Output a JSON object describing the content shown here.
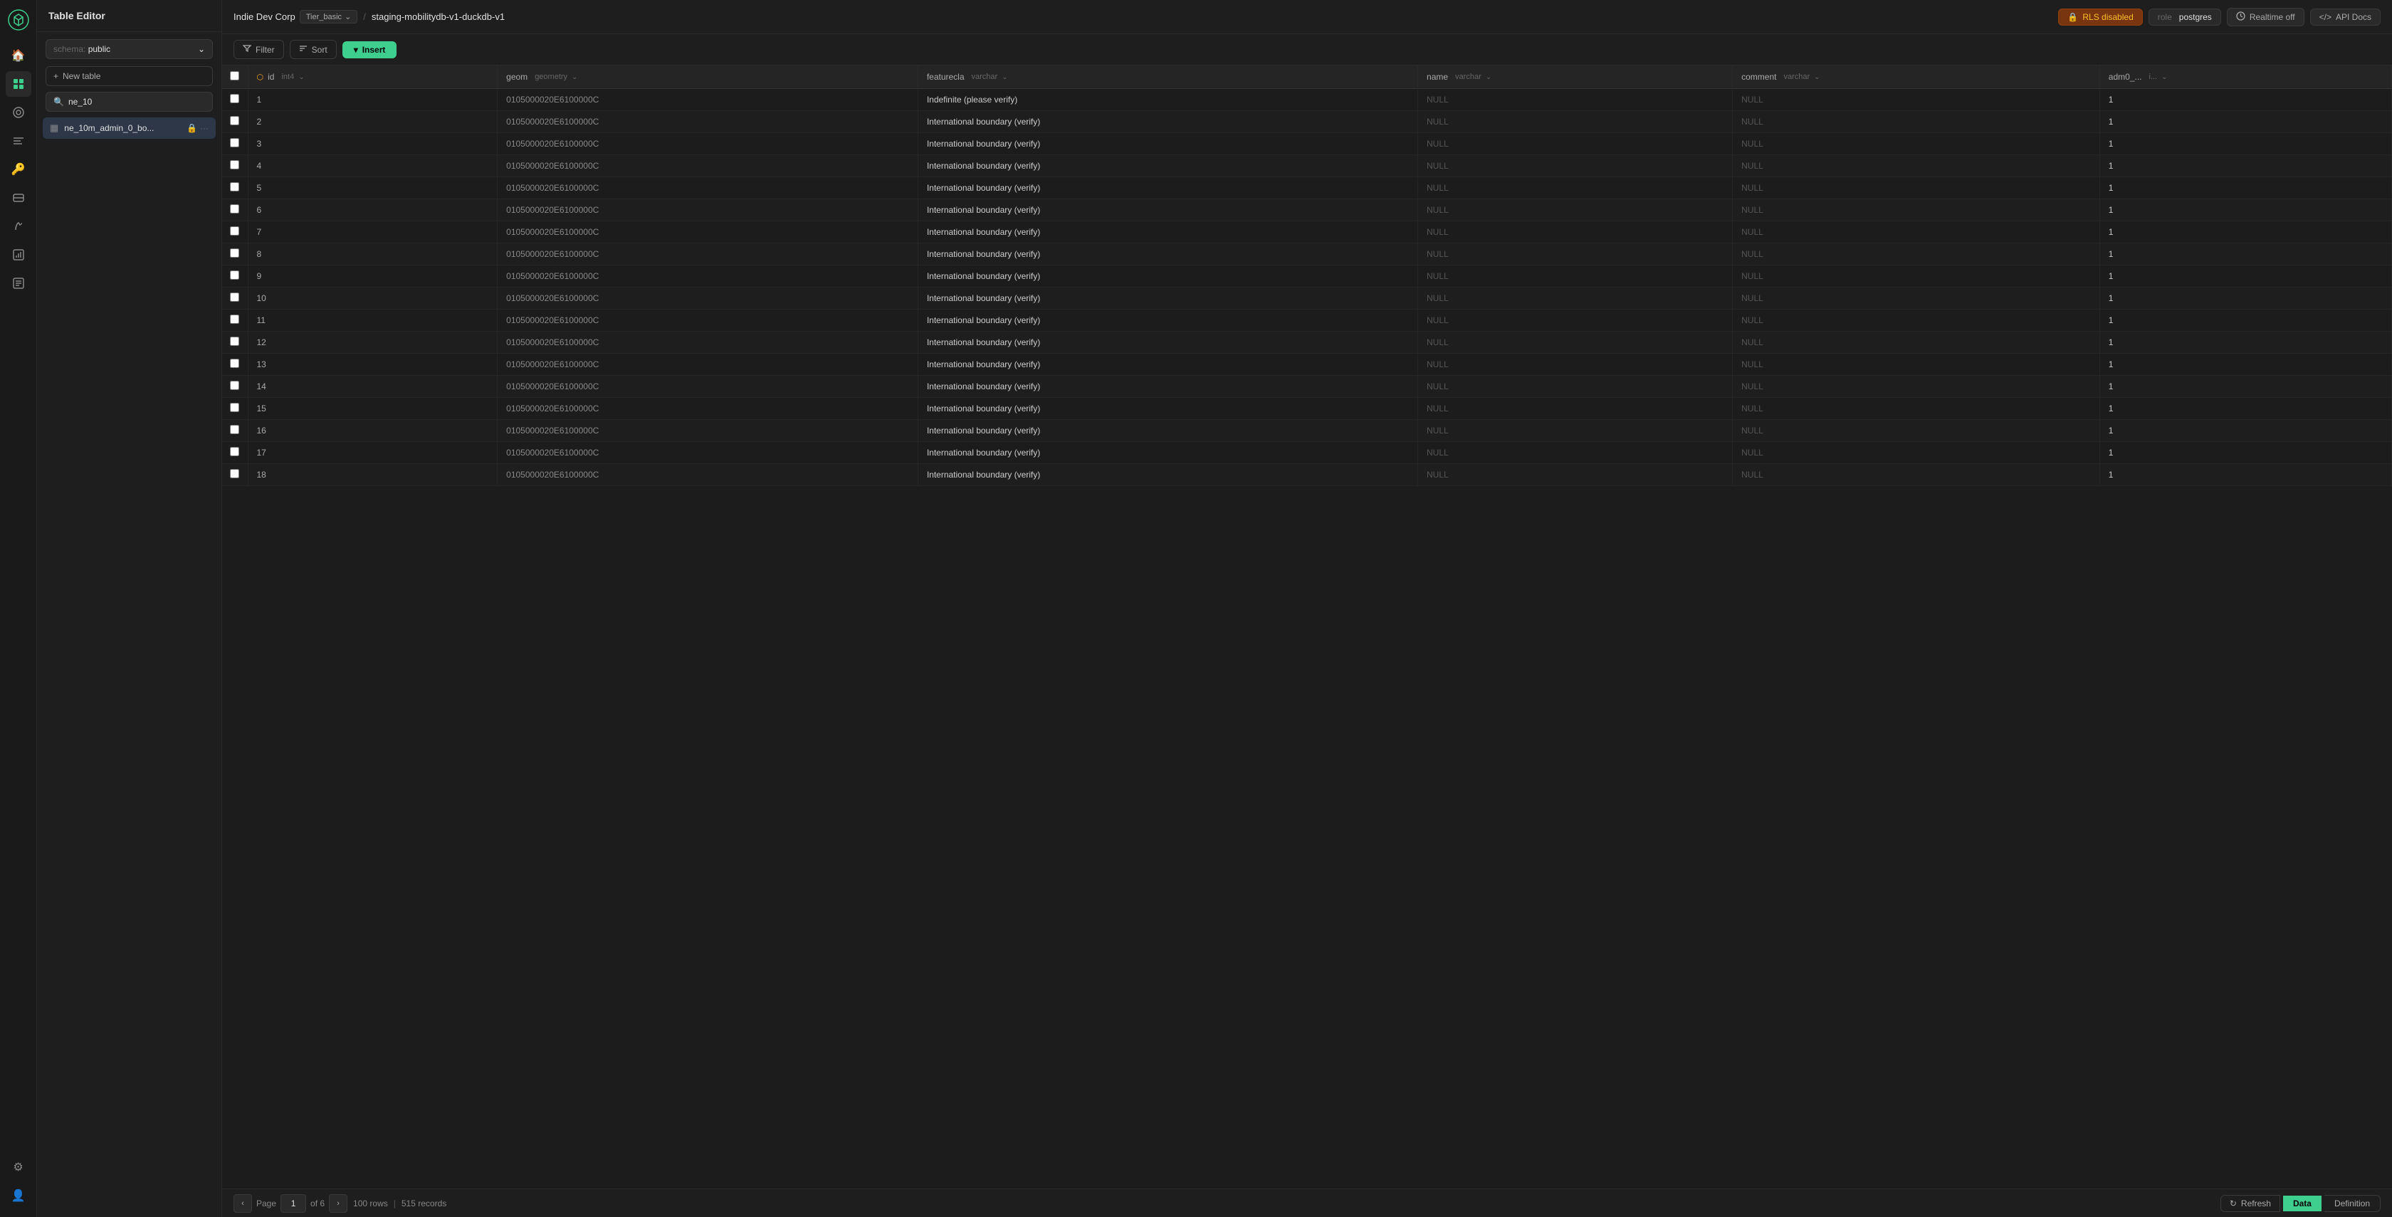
{
  "app": {
    "title": "Table Editor"
  },
  "sidebar": {
    "icons": [
      {
        "name": "home-icon",
        "glyph": "⌂",
        "active": false
      },
      {
        "name": "table-editor-icon",
        "glyph": "▦",
        "active": true
      },
      {
        "name": "schema-icon",
        "glyph": "◈",
        "active": false
      },
      {
        "name": "sql-editor-icon",
        "glyph": "≡",
        "active": false
      },
      {
        "name": "auth-icon",
        "glyph": "🔑",
        "active": false
      },
      {
        "name": "storage-icon",
        "glyph": "📁",
        "active": false
      },
      {
        "name": "functions-icon",
        "glyph": "ƒ",
        "active": false
      },
      {
        "name": "reports-icon",
        "glyph": "📊",
        "active": false
      },
      {
        "name": "logs-icon",
        "glyph": "📋",
        "active": false
      }
    ],
    "bottom_icons": [
      {
        "name": "settings-icon",
        "glyph": "⚙",
        "active": false
      },
      {
        "name": "user-icon",
        "glyph": "👤",
        "active": false
      }
    ]
  },
  "left_panel": {
    "title": "Table Editor",
    "schema_label": "schema:",
    "schema_value": "public",
    "new_table_label": "New table",
    "search_placeholder": "ne_10",
    "tables": [
      {
        "name": "ne_10m_admin_0_bo...",
        "locked": true
      }
    ]
  },
  "topbar": {
    "org": "Indie Dev Corp",
    "tier": "Tier_basic",
    "separator": "/",
    "db": "staging-mobilitydb-v1-duckdb-v1",
    "rls_label": "RLS disabled",
    "role_prefix": "role",
    "role_value": "postgres",
    "realtime_label": "Realtime off",
    "api_docs_label": "API Docs"
  },
  "toolbar": {
    "filter_label": "Filter",
    "sort_label": "Sort",
    "insert_label": "Insert"
  },
  "table": {
    "columns": [
      {
        "name": "id",
        "type": "int4",
        "is_pk": true
      },
      {
        "name": "geom",
        "type": "geometry"
      },
      {
        "name": "featurecla",
        "type": "varchar"
      },
      {
        "name": "name",
        "type": "varchar"
      },
      {
        "name": "comment",
        "type": "varchar"
      },
      {
        "name": "adm0_...",
        "type": "i..."
      }
    ],
    "rows": [
      {
        "id": "1",
        "geom": "0105000020E6100000C",
        "featurecla": "Indefinite (please verify)",
        "name": "NULL",
        "comment": "NULL",
        "adm0": "1"
      },
      {
        "id": "2",
        "geom": "0105000020E6100000C",
        "featurecla": "International boundary (verify)",
        "name": "NULL",
        "comment": "NULL",
        "adm0": "1"
      },
      {
        "id": "3",
        "geom": "0105000020E6100000C",
        "featurecla": "International boundary (verify)",
        "name": "NULL",
        "comment": "NULL",
        "adm0": "1"
      },
      {
        "id": "4",
        "geom": "0105000020E6100000C",
        "featurecla": "International boundary (verify)",
        "name": "NULL",
        "comment": "NULL",
        "adm0": "1"
      },
      {
        "id": "5",
        "geom": "0105000020E6100000C",
        "featurecla": "International boundary (verify)",
        "name": "NULL",
        "comment": "NULL",
        "adm0": "1"
      },
      {
        "id": "6",
        "geom": "0105000020E6100000C",
        "featurecla": "International boundary (verify)",
        "name": "NULL",
        "comment": "NULL",
        "adm0": "1"
      },
      {
        "id": "7",
        "geom": "0105000020E6100000C",
        "featurecla": "International boundary (verify)",
        "name": "NULL",
        "comment": "NULL",
        "adm0": "1"
      },
      {
        "id": "8",
        "geom": "0105000020E6100000C",
        "featurecla": "International boundary (verify)",
        "name": "NULL",
        "comment": "NULL",
        "adm0": "1"
      },
      {
        "id": "9",
        "geom": "0105000020E6100000C",
        "featurecla": "International boundary (verify)",
        "name": "NULL",
        "comment": "NULL",
        "adm0": "1"
      },
      {
        "id": "10",
        "geom": "0105000020E6100000C",
        "featurecla": "International boundary (verify)",
        "name": "NULL",
        "comment": "NULL",
        "adm0": "1"
      },
      {
        "id": "11",
        "geom": "0105000020E6100000C",
        "featurecla": "International boundary (verify)",
        "name": "NULL",
        "comment": "NULL",
        "adm0": "1"
      },
      {
        "id": "12",
        "geom": "0105000020E6100000C",
        "featurecla": "International boundary (verify)",
        "name": "NULL",
        "comment": "NULL",
        "adm0": "1"
      },
      {
        "id": "13",
        "geom": "0105000020E6100000C",
        "featurecla": "International boundary (verify)",
        "name": "NULL",
        "comment": "NULL",
        "adm0": "1"
      },
      {
        "id": "14",
        "geom": "0105000020E6100000C",
        "featurecla": "International boundary (verify)",
        "name": "NULL",
        "comment": "NULL",
        "adm0": "1"
      },
      {
        "id": "15",
        "geom": "0105000020E6100000C",
        "featurecla": "International boundary (verify)",
        "name": "NULL",
        "comment": "NULL",
        "adm0": "1"
      },
      {
        "id": "16",
        "geom": "0105000020E6100000C",
        "featurecla": "International boundary (verify)",
        "name": "NULL",
        "comment": "NULL",
        "adm0": "1"
      },
      {
        "id": "17",
        "geom": "0105000020E6100000C",
        "featurecla": "International boundary (verify)",
        "name": "NULL",
        "comment": "NULL",
        "adm0": "1"
      },
      {
        "id": "18",
        "geom": "0105000020E6100000C",
        "featurecla": "International boundary (verify)",
        "name": "NULL",
        "comment": "NULL",
        "adm0": "1"
      }
    ]
  },
  "pagination": {
    "page_label": "Page",
    "current_page": "1",
    "of_label": "of 6",
    "rows_per_page": "100 rows",
    "total_records": "515 records"
  },
  "bottom_bar": {
    "refresh_label": "Refresh",
    "data_label": "Data",
    "definition_label": "Definition"
  },
  "colors": {
    "accent": "#3ecf8e",
    "rls_bg": "#78350f",
    "rls_text": "#fbbf24"
  }
}
